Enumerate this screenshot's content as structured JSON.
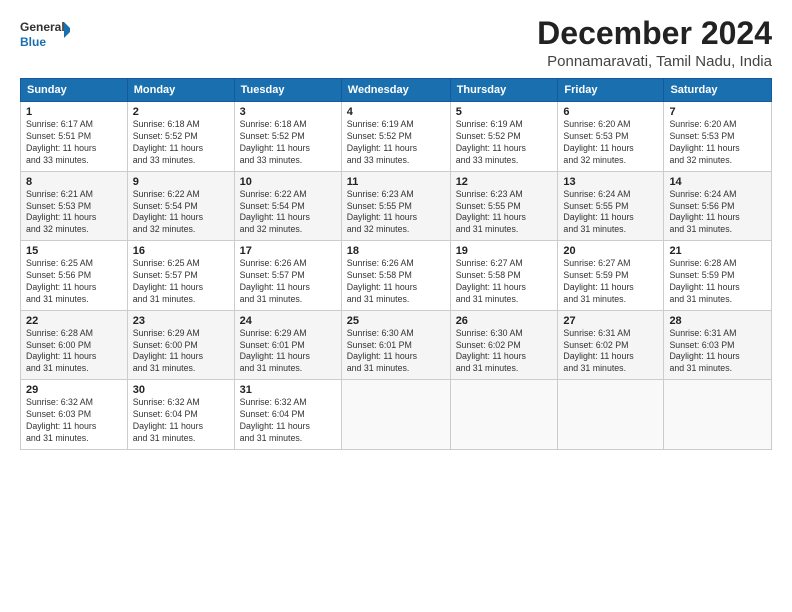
{
  "logo": {
    "line1": "General",
    "line2": "Blue"
  },
  "title": "December 2024",
  "subtitle": "Ponnamaravati, Tamil Nadu, India",
  "weekdays": [
    "Sunday",
    "Monday",
    "Tuesday",
    "Wednesday",
    "Thursday",
    "Friday",
    "Saturday"
  ],
  "weeks": [
    [
      {
        "day": "1",
        "info": "Sunrise: 6:17 AM\nSunset: 5:51 PM\nDaylight: 11 hours\nand 33 minutes."
      },
      {
        "day": "2",
        "info": "Sunrise: 6:18 AM\nSunset: 5:52 PM\nDaylight: 11 hours\nand 33 minutes."
      },
      {
        "day": "3",
        "info": "Sunrise: 6:18 AM\nSunset: 5:52 PM\nDaylight: 11 hours\nand 33 minutes."
      },
      {
        "day": "4",
        "info": "Sunrise: 6:19 AM\nSunset: 5:52 PM\nDaylight: 11 hours\nand 33 minutes."
      },
      {
        "day": "5",
        "info": "Sunrise: 6:19 AM\nSunset: 5:52 PM\nDaylight: 11 hours\nand 33 minutes."
      },
      {
        "day": "6",
        "info": "Sunrise: 6:20 AM\nSunset: 5:53 PM\nDaylight: 11 hours\nand 32 minutes."
      },
      {
        "day": "7",
        "info": "Sunrise: 6:20 AM\nSunset: 5:53 PM\nDaylight: 11 hours\nand 32 minutes."
      }
    ],
    [
      {
        "day": "8",
        "info": "Sunrise: 6:21 AM\nSunset: 5:53 PM\nDaylight: 11 hours\nand 32 minutes."
      },
      {
        "day": "9",
        "info": "Sunrise: 6:22 AM\nSunset: 5:54 PM\nDaylight: 11 hours\nand 32 minutes."
      },
      {
        "day": "10",
        "info": "Sunrise: 6:22 AM\nSunset: 5:54 PM\nDaylight: 11 hours\nand 32 minutes."
      },
      {
        "day": "11",
        "info": "Sunrise: 6:23 AM\nSunset: 5:55 PM\nDaylight: 11 hours\nand 32 minutes."
      },
      {
        "day": "12",
        "info": "Sunrise: 6:23 AM\nSunset: 5:55 PM\nDaylight: 11 hours\nand 31 minutes."
      },
      {
        "day": "13",
        "info": "Sunrise: 6:24 AM\nSunset: 5:55 PM\nDaylight: 11 hours\nand 31 minutes."
      },
      {
        "day": "14",
        "info": "Sunrise: 6:24 AM\nSunset: 5:56 PM\nDaylight: 11 hours\nand 31 minutes."
      }
    ],
    [
      {
        "day": "15",
        "info": "Sunrise: 6:25 AM\nSunset: 5:56 PM\nDaylight: 11 hours\nand 31 minutes."
      },
      {
        "day": "16",
        "info": "Sunrise: 6:25 AM\nSunset: 5:57 PM\nDaylight: 11 hours\nand 31 minutes."
      },
      {
        "day": "17",
        "info": "Sunrise: 6:26 AM\nSunset: 5:57 PM\nDaylight: 11 hours\nand 31 minutes."
      },
      {
        "day": "18",
        "info": "Sunrise: 6:26 AM\nSunset: 5:58 PM\nDaylight: 11 hours\nand 31 minutes."
      },
      {
        "day": "19",
        "info": "Sunrise: 6:27 AM\nSunset: 5:58 PM\nDaylight: 11 hours\nand 31 minutes."
      },
      {
        "day": "20",
        "info": "Sunrise: 6:27 AM\nSunset: 5:59 PM\nDaylight: 11 hours\nand 31 minutes."
      },
      {
        "day": "21",
        "info": "Sunrise: 6:28 AM\nSunset: 5:59 PM\nDaylight: 11 hours\nand 31 minutes."
      }
    ],
    [
      {
        "day": "22",
        "info": "Sunrise: 6:28 AM\nSunset: 6:00 PM\nDaylight: 11 hours\nand 31 minutes."
      },
      {
        "day": "23",
        "info": "Sunrise: 6:29 AM\nSunset: 6:00 PM\nDaylight: 11 hours\nand 31 minutes."
      },
      {
        "day": "24",
        "info": "Sunrise: 6:29 AM\nSunset: 6:01 PM\nDaylight: 11 hours\nand 31 minutes."
      },
      {
        "day": "25",
        "info": "Sunrise: 6:30 AM\nSunset: 6:01 PM\nDaylight: 11 hours\nand 31 minutes."
      },
      {
        "day": "26",
        "info": "Sunrise: 6:30 AM\nSunset: 6:02 PM\nDaylight: 11 hours\nand 31 minutes."
      },
      {
        "day": "27",
        "info": "Sunrise: 6:31 AM\nSunset: 6:02 PM\nDaylight: 11 hours\nand 31 minutes."
      },
      {
        "day": "28",
        "info": "Sunrise: 6:31 AM\nSunset: 6:03 PM\nDaylight: 11 hours\nand 31 minutes."
      }
    ],
    [
      {
        "day": "29",
        "info": "Sunrise: 6:32 AM\nSunset: 6:03 PM\nDaylight: 11 hours\nand 31 minutes."
      },
      {
        "day": "30",
        "info": "Sunrise: 6:32 AM\nSunset: 6:04 PM\nDaylight: 11 hours\nand 31 minutes."
      },
      {
        "day": "31",
        "info": "Sunrise: 6:32 AM\nSunset: 6:04 PM\nDaylight: 11 hours\nand 31 minutes."
      },
      null,
      null,
      null,
      null
    ]
  ]
}
